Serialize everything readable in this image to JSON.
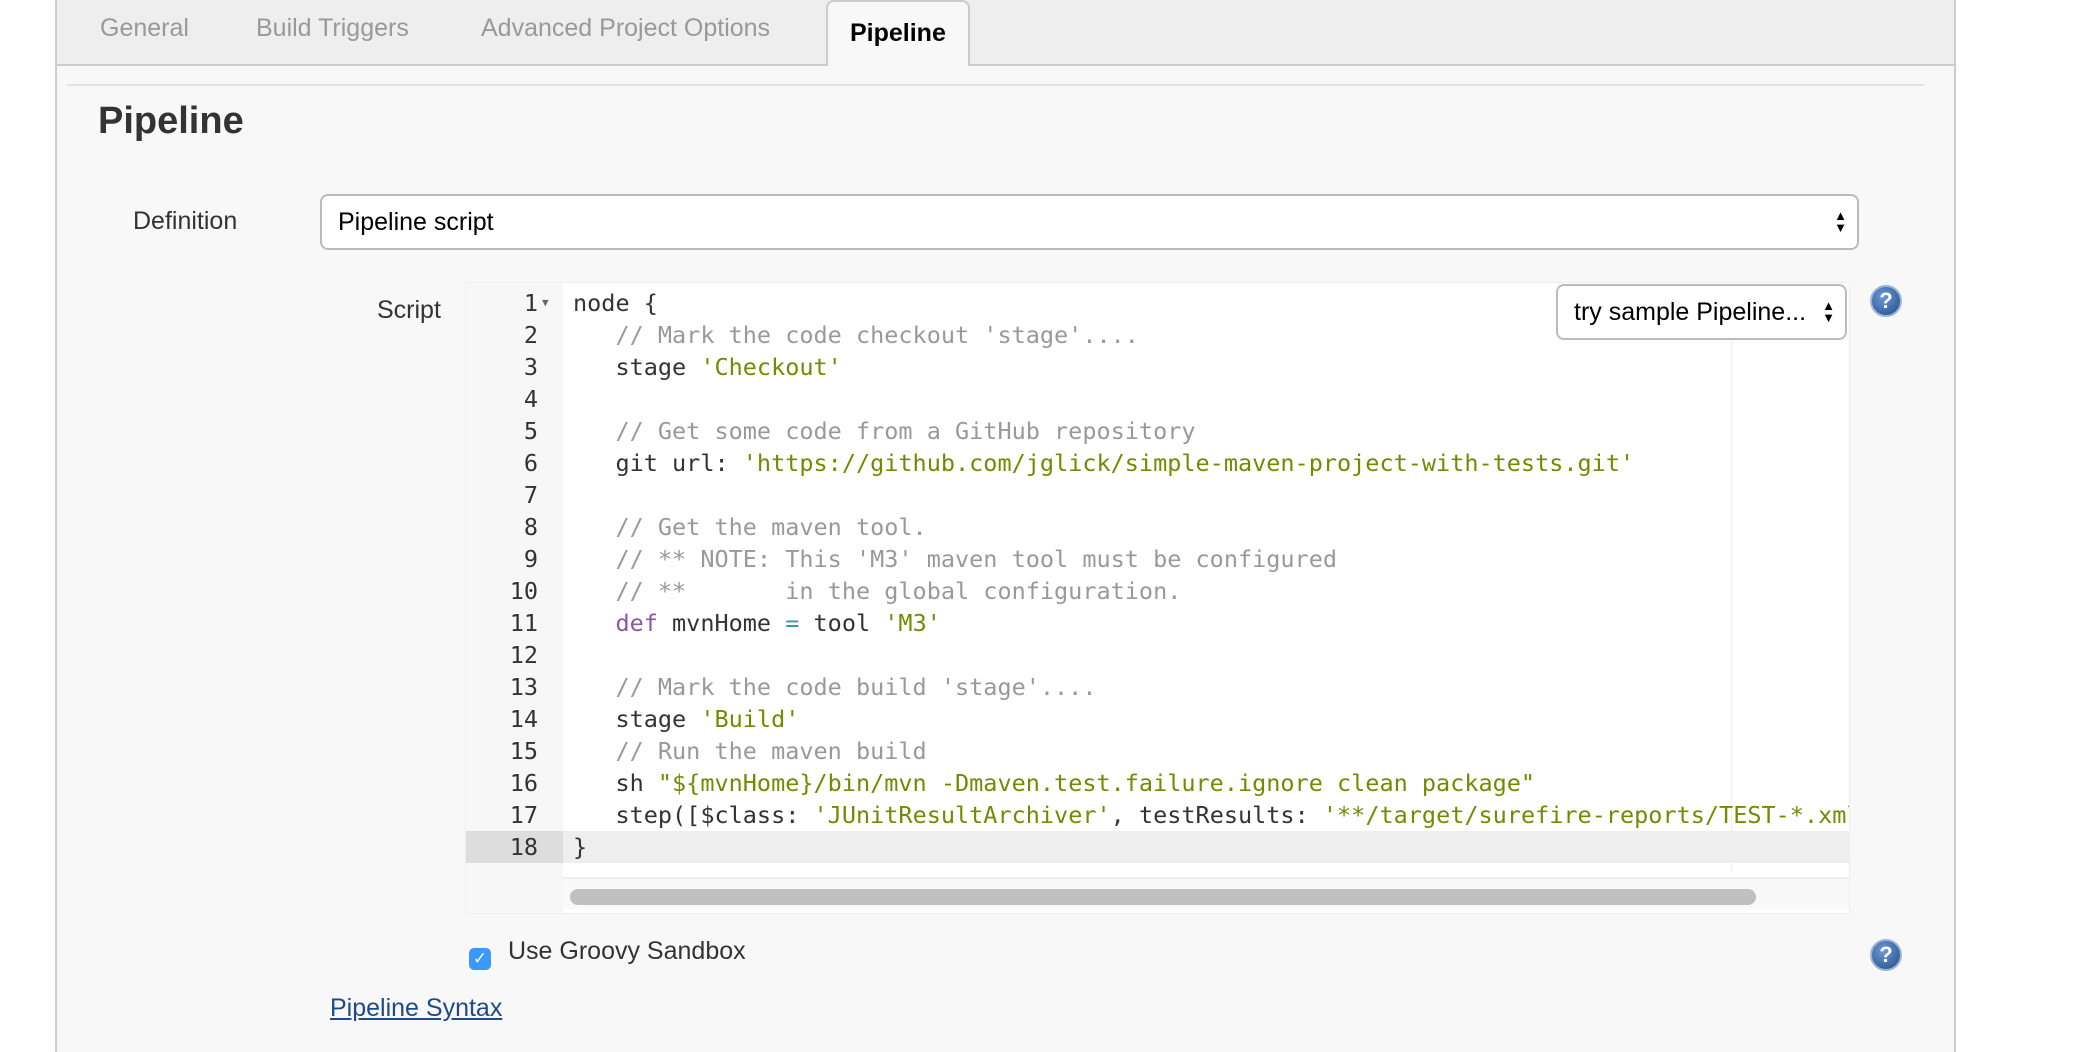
{
  "tabs": [
    {
      "label": "General"
    },
    {
      "label": "Build Triggers"
    },
    {
      "label": "Advanced Project Options"
    },
    {
      "label": "Pipeline",
      "active": true
    }
  ],
  "section_title": "Pipeline",
  "definition": {
    "label": "Definition",
    "value": "Pipeline script"
  },
  "script": {
    "label": "Script",
    "sample_select": "try sample Pipeline...",
    "active_line": 18
  },
  "code_lines": [
    [
      [
        "t",
        "node {"
      ]
    ],
    [
      [
        "c",
        "   // Mark the code checkout 'stage'...."
      ]
    ],
    [
      [
        "t",
        "   stage "
      ],
      [
        "s",
        "'Checkout'"
      ]
    ],
    [
      [
        "t",
        ""
      ]
    ],
    [
      [
        "c",
        "   // Get some code from a GitHub repository"
      ]
    ],
    [
      [
        "t",
        "   git url: "
      ],
      [
        "s",
        "'https://github.com/jglick/simple-maven-project-with-tests.git'"
      ]
    ],
    [
      [
        "t",
        ""
      ]
    ],
    [
      [
        "c",
        "   // Get the maven tool."
      ]
    ],
    [
      [
        "c",
        "   // ** NOTE: This 'M3' maven tool must be configured"
      ]
    ],
    [
      [
        "c",
        "   // **       in the global configuration."
      ]
    ],
    [
      [
        "k",
        "   def"
      ],
      [
        "t",
        " mvnHome "
      ],
      [
        "o",
        "="
      ],
      [
        "t",
        " tool "
      ],
      [
        "s",
        "'M3'"
      ]
    ],
    [
      [
        "t",
        ""
      ]
    ],
    [
      [
        "c",
        "   // Mark the code build 'stage'...."
      ]
    ],
    [
      [
        "t",
        "   stage "
      ],
      [
        "s",
        "'Build'"
      ]
    ],
    [
      [
        "c",
        "   // Run the maven build"
      ]
    ],
    [
      [
        "t",
        "   sh "
      ],
      [
        "s",
        "\"${mvnHome}/bin/mvn -Dmaven.test.failure.ignore clean package\""
      ]
    ],
    [
      [
        "t",
        "   step([$class: "
      ],
      [
        "s",
        "'JUnitResultArchiver'"
      ],
      [
        "t",
        ", testResults: "
      ],
      [
        "s",
        "'**/target/surefire-reports/TEST-*.xml'"
      ],
      [
        "t",
        "])"
      ]
    ],
    [
      [
        "t",
        "}"
      ]
    ]
  ],
  "sandbox": {
    "label": "Use Groovy Sandbox",
    "checked": true
  },
  "pipeline_syntax_link": "Pipeline Syntax",
  "icons": {
    "help": "help-icon",
    "check": "checkmark-icon"
  },
  "colors": {
    "link": "#204a87",
    "checkbox": "#3b99fc",
    "string": "#718c00",
    "comment": "#999999",
    "keyword": "#8959a8"
  }
}
